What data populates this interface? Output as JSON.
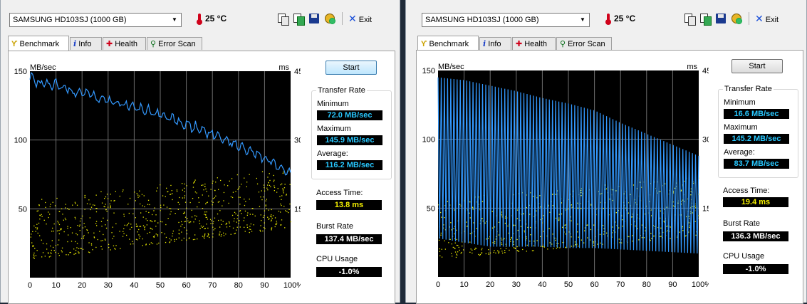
{
  "windows": [
    {
      "drive": "SAMSUNG HD103SJ (1000 GB)",
      "temperature": "25 °C",
      "exit_label": "Exit",
      "tabs": [
        "Benchmark",
        "Info",
        "Health",
        "Error Scan"
      ],
      "start_label": "Start",
      "left_unit": "MB/sec",
      "right_unit": "ms",
      "transfer_rate": {
        "title": "Transfer Rate",
        "minimum_label": "Minimum",
        "minimum": "72.0 MB/sec",
        "maximum_label": "Maximum",
        "maximum": "145.9 MB/sec",
        "average_label": "Average:",
        "average": "116.2 MB/sec"
      },
      "access_time_label": "Access Time:",
      "access_time": "13.8 ms",
      "burst_rate_label": "Burst Rate",
      "burst_rate": "137.4 MB/sec",
      "cpu_usage_label": "CPU Usage",
      "cpu_usage": "-1.0%",
      "chart_data": {
        "type": "line",
        "x_ticks": [
          "0",
          "10",
          "20",
          "30",
          "40",
          "50",
          "60",
          "70",
          "80",
          "90",
          "100%"
        ],
        "y_left_ticks": [
          "150",
          "100",
          "50"
        ],
        "y_right_ticks": [
          "45",
          "30",
          "15"
        ],
        "xlim": [
          0,
          100
        ],
        "ylim": [
          0,
          150
        ],
        "y2lim": [
          0,
          45
        ],
        "grid": true,
        "transfer_rate_series": {
          "x": [
            0,
            2,
            4,
            6,
            8,
            10,
            12,
            14,
            16,
            18,
            20,
            22,
            24,
            26,
            28,
            30,
            32,
            34,
            36,
            38,
            40,
            42,
            44,
            46,
            48,
            50,
            52,
            54,
            56,
            58,
            60,
            62,
            64,
            66,
            68,
            70,
            72,
            74,
            76,
            78,
            80,
            82,
            84,
            86,
            88,
            90,
            92,
            94,
            96,
            98,
            100
          ],
          "y": [
            145,
            143,
            141,
            142,
            139,
            140,
            138,
            138,
            136,
            135,
            135,
            134,
            132,
            131,
            131,
            129,
            128,
            127,
            126,
            125,
            124,
            123,
            122,
            121,
            119,
            118,
            117,
            116,
            114,
            113,
            112,
            110,
            109,
            107,
            106,
            104,
            103,
            101,
            99,
            98,
            96,
            94,
            93,
            91,
            89,
            87,
            85,
            83,
            80,
            77,
            74
          ],
          "ripple": 4.5,
          "color": "#3399ff"
        },
        "access_time_scatter": {
          "x_range": [
            0,
            100
          ],
          "y_start": [
            4,
            17
          ],
          "y_end": [
            11,
            24
          ],
          "count": 700,
          "color": "#e8e800"
        }
      }
    },
    {
      "drive": "SAMSUNG HD103SJ (1000 GB)",
      "temperature": "25 °C",
      "exit_label": "Exit",
      "tabs": [
        "Benchmark",
        "Info",
        "Health",
        "Error Scan"
      ],
      "start_label": "Start",
      "left_unit": "MB/sec",
      "right_unit": "ms",
      "transfer_rate": {
        "title": "Transfer Rate",
        "minimum_label": "Minimum",
        "minimum": "16.6 MB/sec",
        "maximum_label": "Maximum",
        "maximum": "145.2 MB/sec",
        "average_label": "Average:",
        "average": "83.7 MB/sec"
      },
      "access_time_label": "Access Time:",
      "access_time": "19.4 ms",
      "burst_rate_label": "Burst Rate",
      "burst_rate": "136.3 MB/sec",
      "cpu_usage_label": "CPU Usage",
      "cpu_usage": "-1.0%",
      "chart_data": {
        "type": "line",
        "x_ticks": [
          "0",
          "10",
          "20",
          "30",
          "40",
          "50",
          "60",
          "70",
          "80",
          "90",
          "100%"
        ],
        "y_left_ticks": [
          "150",
          "100",
          "50"
        ],
        "y_right_ticks": [
          "45",
          "30",
          "15"
        ],
        "xlim": [
          0,
          100
        ],
        "ylim": [
          0,
          150
        ],
        "y2lim": [
          0,
          45
        ],
        "grid": true,
        "transfer_rate_series": {
          "x": [
            0,
            10,
            20,
            30,
            40,
            50,
            60,
            70,
            80,
            90,
            100
          ],
          "y_max": [
            145,
            143,
            139,
            135,
            130,
            126,
            121,
            112,
            104,
            96,
            88
          ],
          "y_min": [
            28,
            25,
            22,
            22,
            22,
            21,
            21,
            20,
            19,
            18,
            17
          ],
          "cycles": 82,
          "color": "#3399ff"
        },
        "access_time_scatter": {
          "x_range": [
            0,
            100
          ],
          "y_start": [
            4,
            17
          ],
          "y_end": [
            9,
            22
          ],
          "count": 650,
          "color": "#e8e800"
        }
      }
    }
  ]
}
